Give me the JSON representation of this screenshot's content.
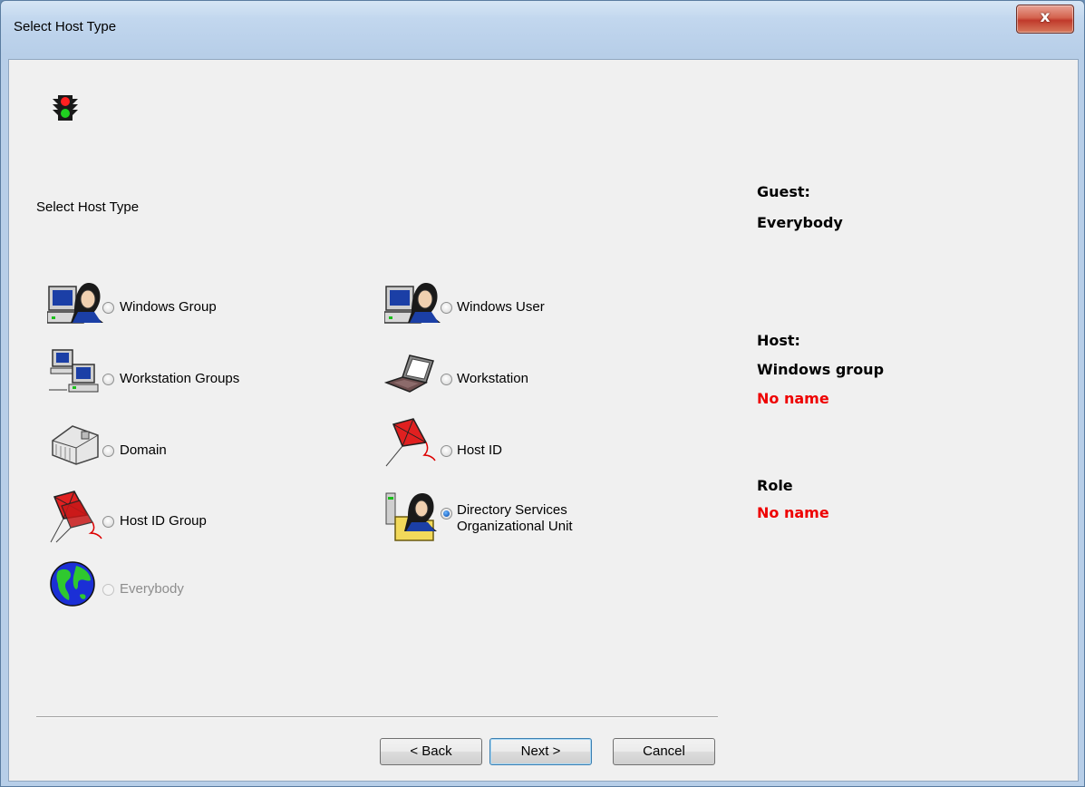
{
  "window": {
    "title": "Select Host Type",
    "close_glyph": "x"
  },
  "main": {
    "header": "Select Host Type",
    "options": [
      {
        "key": "windows_group",
        "label": "Windows Group",
        "icon": "computer-user-icon",
        "selected": false,
        "enabled": true
      },
      {
        "key": "windows_user",
        "label": "Windows User",
        "icon": "computer-user-icon",
        "selected": false,
        "enabled": true
      },
      {
        "key": "workstation_groups",
        "label": "Workstation Groups",
        "icon": "networked-computers-icon",
        "selected": false,
        "enabled": true
      },
      {
        "key": "workstation",
        "label": "Workstation",
        "icon": "laptop-icon",
        "selected": false,
        "enabled": true
      },
      {
        "key": "domain",
        "label": "Domain",
        "icon": "building-icon",
        "selected": false,
        "enabled": true
      },
      {
        "key": "host_id",
        "label": "Host ID",
        "icon": "kite-icon",
        "selected": false,
        "enabled": true
      },
      {
        "key": "host_id_group",
        "label": "Host ID Group",
        "icon": "kite-icon",
        "selected": false,
        "enabled": true
      },
      {
        "key": "directory_services_ou",
        "label_line1": "Directory Services",
        "label_line2": "Organizational Unit",
        "icon": "directory-folder-user-icon",
        "selected": true,
        "enabled": true
      },
      {
        "key": "everybody",
        "label": "Everybody",
        "icon": "globe-icon",
        "selected": false,
        "enabled": false
      }
    ]
  },
  "side": {
    "guest_label": "Guest:",
    "guest_value": "Everybody",
    "host_label": "Host:",
    "host_value": "Windows group",
    "host_name": "No name",
    "role_label": "Role",
    "role_name": "No name"
  },
  "buttons": {
    "back": "< Back",
    "next": "Next >",
    "cancel": "Cancel"
  },
  "colors": {
    "accent_red": "#ee0000",
    "selected_radio": "#1f66c4"
  }
}
